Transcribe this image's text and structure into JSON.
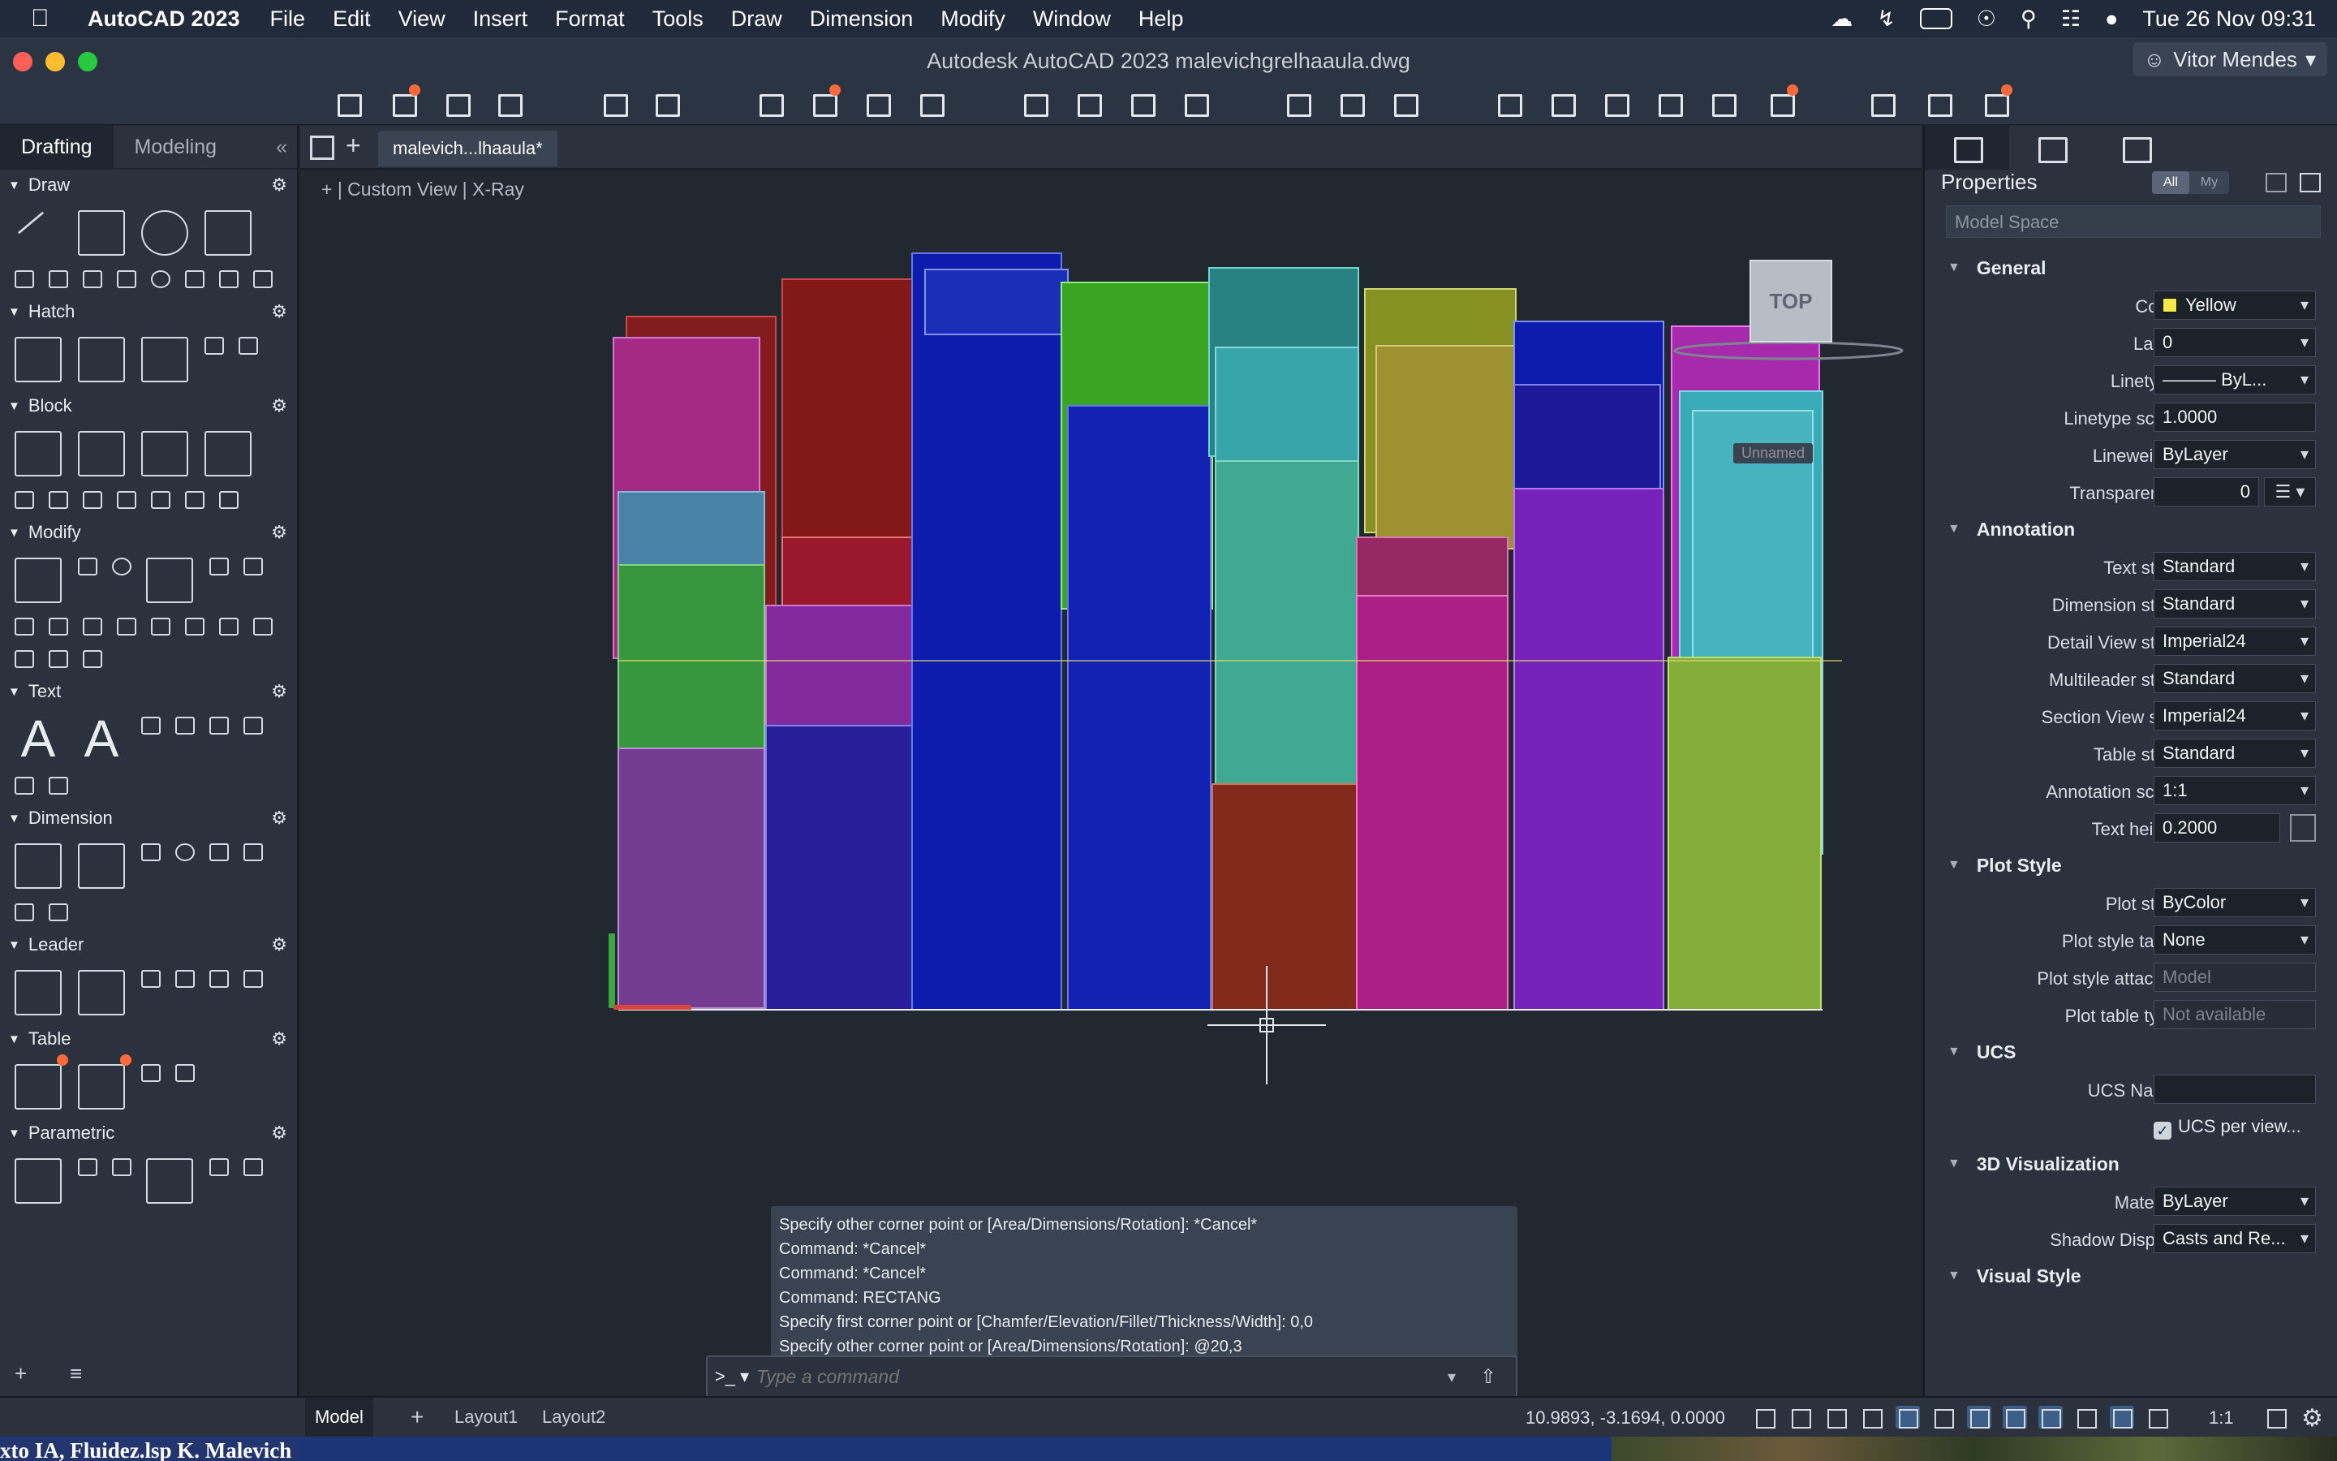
{
  "menubar": {
    "app_name": "AutoCAD 2023",
    "items": [
      "File",
      "Edit",
      "View",
      "Insert",
      "Format",
      "Tools",
      "Draw",
      "Dimension",
      "Modify",
      "Window",
      "Help"
    ],
    "datetime": "Tue 26 Nov  09:31"
  },
  "window": {
    "title": "Autodesk AutoCAD 2023    malevichgrelhaaula.dwg",
    "user": "Vitor Mendes"
  },
  "left_palette": {
    "tabs": [
      "Drafting",
      "Modeling"
    ],
    "sections": [
      "Draw",
      "Hatch",
      "Block",
      "Modify",
      "Text",
      "Dimension",
      "Leader",
      "Table",
      "Parametric"
    ]
  },
  "document": {
    "tab": "malevich...lhaaula*",
    "viewport_label": "+  |  Custom View  |  X-Ray",
    "viewcube": "TOP",
    "ucs_name_badge": "Unnamed"
  },
  "command": {
    "history": [
      "Specify other corner point or [Area/Dimensions/Rotation]: *Cancel*",
      "Command: *Cancel*",
      "Command: *Cancel*",
      "Command: RECTANG",
      "Specify first corner point or [Chamfer/Elevation/Fillet/Thickness/Width]: 0,0",
      "Specify other corner point or [Area/Dimensions/Rotation]: @20,3"
    ],
    "prompt": ">_ ▾",
    "placeholder": "Type a command"
  },
  "properties": {
    "title": "Properties",
    "filter_all": "All",
    "filter_my": "My",
    "selection": "Model Space",
    "groups": [
      {
        "name": "General",
        "rows": [
          {
            "label": "Color",
            "value": "Yellow",
            "dd": true
          },
          {
            "label": "Layer",
            "value": "0",
            "dd": true
          },
          {
            "label": "Linetype",
            "value": "——— ByL...",
            "dd": true
          },
          {
            "label": "Linetype scale",
            "value": "1.0000",
            "dd": false
          },
          {
            "label": "Lineweight",
            "value": "ByLayer",
            "dd": true
          },
          {
            "label": "Transparency",
            "value": "0",
            "dd": false
          }
        ]
      },
      {
        "name": "Annotation",
        "rows": [
          {
            "label": "Text style",
            "value": "Standard",
            "dd": true
          },
          {
            "label": "Dimension style",
            "value": "Standard",
            "dd": true
          },
          {
            "label": "Detail View style",
            "value": "Imperial24",
            "dd": true
          },
          {
            "label": "Multileader style",
            "value": "Standard",
            "dd": true
          },
          {
            "label": "Section View st...",
            "value": "Imperial24",
            "dd": true
          },
          {
            "label": "Table style",
            "value": "Standard",
            "dd": true
          },
          {
            "label": "Annotation scale",
            "value": "1:1",
            "dd": true
          },
          {
            "label": "Text height",
            "value": "0.2000",
            "dd": false
          }
        ]
      },
      {
        "name": "Plot Style",
        "rows": [
          {
            "label": "Plot style",
            "value": "ByColor",
            "dd": true
          },
          {
            "label": "Plot style table",
            "value": "None",
            "dd": true
          },
          {
            "label": "Plot style attach...",
            "value": "Model",
            "dd": false,
            "disabled": true
          },
          {
            "label": "Plot table type",
            "value": "Not available",
            "dd": false,
            "disabled": true
          }
        ]
      },
      {
        "name": "UCS",
        "rows": [
          {
            "label": "UCS Name",
            "value": "",
            "dd": false
          },
          {
            "label": "",
            "value": "UCS per view...",
            "dd": false,
            "checkbox": true
          }
        ]
      },
      {
        "name": "3D Visualization",
        "rows": [
          {
            "label": "Material",
            "value": "ByLayer",
            "dd": true
          },
          {
            "label": "Shadow Display",
            "value": "Casts and Re...",
            "dd": true
          }
        ]
      },
      {
        "name": "Visual Style",
        "rows": []
      }
    ]
  },
  "statusbar": {
    "tabs": [
      "Model",
      "Layout1",
      "Layout2"
    ],
    "coords": "10.9893, -3.1694, 0.0000",
    "scale": "1:1"
  },
  "bottom_strip": {
    "text": "xto IA, Fluidez.lsp K. Malevich"
  },
  "colors": {
    "accent": "#3c5f8a",
    "notification": "#ff6a3d"
  }
}
